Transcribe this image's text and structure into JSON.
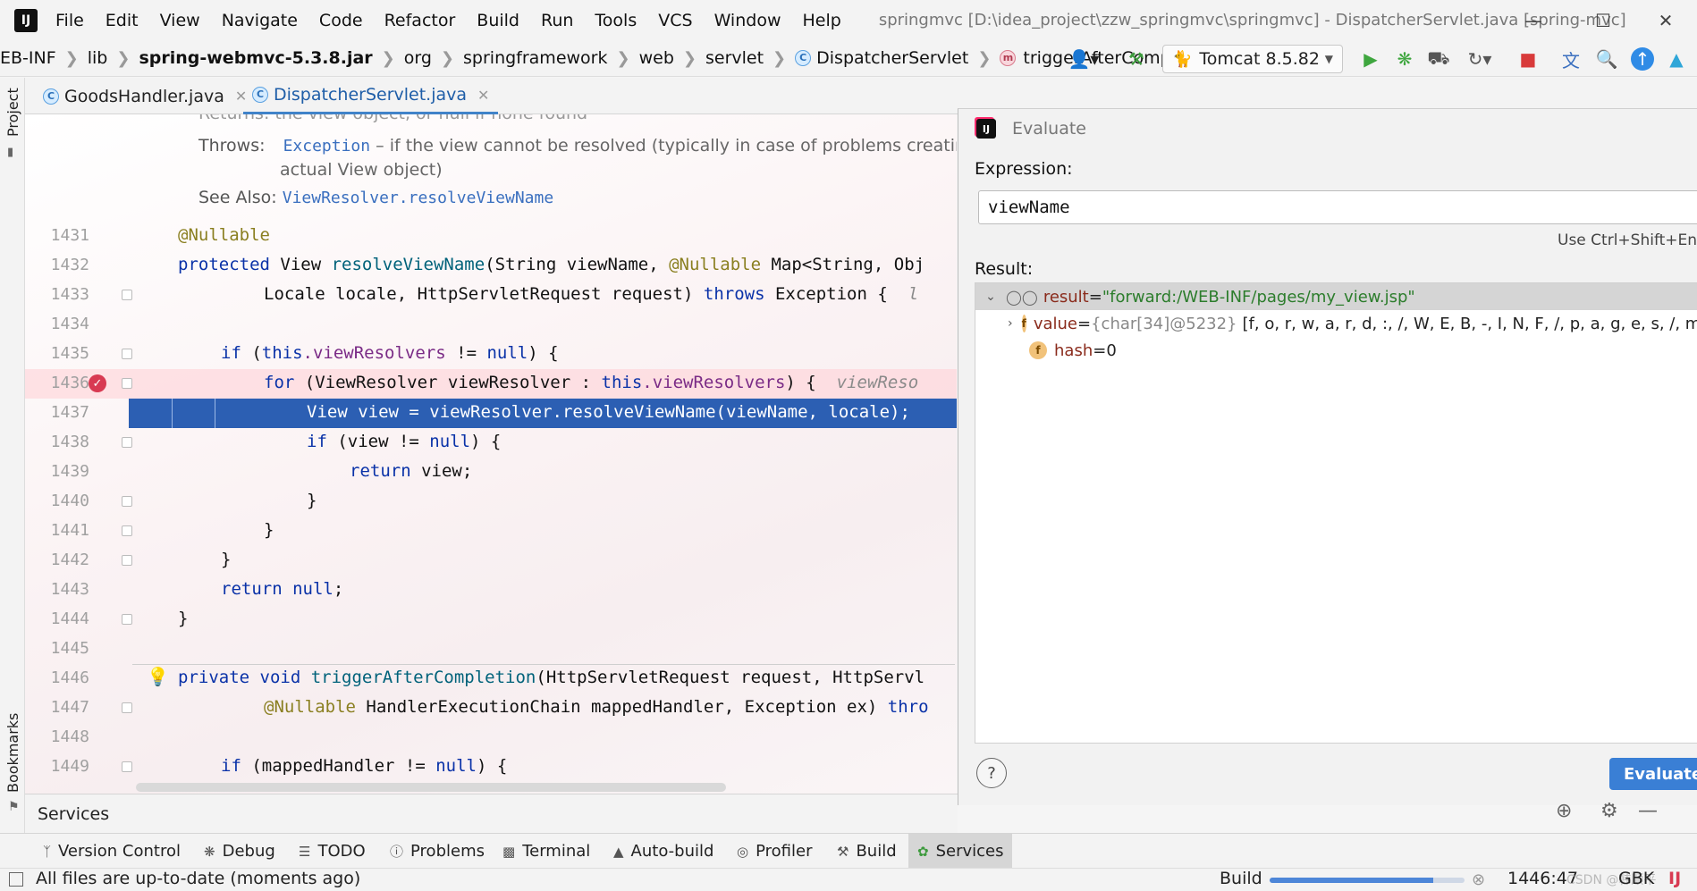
{
  "menubar": {
    "items": [
      "File",
      "Edit",
      "View",
      "Navigate",
      "Code",
      "Refactor",
      "Build",
      "Run",
      "Tools",
      "VCS",
      "Window",
      "Help"
    ],
    "window_title": "springmvc [D:\\idea_project\\zzw_springmvc\\springmvc] - DispatcherServlet.java [spring-mvc]"
  },
  "breadcrumbs": {
    "items": [
      "EB-INF",
      "lib",
      "spring-webmvc-5.3.8.jar",
      "org",
      "springframework",
      "web",
      "servlet",
      "DispatcherServlet",
      "triggerAfterCompletion"
    ]
  },
  "run_config": {
    "label": "Tomcat 8.5.82"
  },
  "left_stripe": {
    "project": "Project",
    "bookmarks": "Bookmarks"
  },
  "editor_tabs": [
    {
      "label": "GoodsHandler.java",
      "active": false
    },
    {
      "label": "DispatcherServlet.java",
      "active": true
    }
  ],
  "doc": {
    "returns_line": "Returns:  the view object, or null if none found",
    "throws_key": "Throws:",
    "throws_link": "Exception",
    "throws_text": " – if the view cannot be resolved (typically in case of problems creating",
    "throws_text2": "actual View object)",
    "see_also_key": "See Also:",
    "see_also_link": "ViewResolver.resolveViewName"
  },
  "code_lines": [
    {
      "n": "1431"
    },
    {
      "n": "1432"
    },
    {
      "n": "1433"
    },
    {
      "n": "1434"
    },
    {
      "n": "1435"
    },
    {
      "n": "1436"
    },
    {
      "n": "1437"
    },
    {
      "n": "1438"
    },
    {
      "n": "1439"
    },
    {
      "n": "1440"
    },
    {
      "n": "1441"
    },
    {
      "n": "1442"
    },
    {
      "n": "1443"
    },
    {
      "n": "1444"
    },
    {
      "n": "1445"
    },
    {
      "n": "1446"
    },
    {
      "n": "1447"
    },
    {
      "n": "1448"
    },
    {
      "n": "1449"
    }
  ],
  "code": {
    "l1431": "@Nullable",
    "l1432_kw": "protected ",
    "l1432_a": "View ",
    "l1432_fn": "resolveViewName",
    "l1432_b": "(String viewName, ",
    "l1432_ann": "@Nullable ",
    "l1432_c": "Map<String, Obj",
    "l1433_a": "Locale locale, HttpServletRequest request) ",
    "l1433_kw": "throws ",
    "l1433_b": "Exception {  ",
    "l1433_hint": "l",
    "l1435_kw": "if ",
    "l1435_a": "(",
    "l1435_this": "this",
    "l1435_fld": ".viewResolvers",
    "l1435_b": " != ",
    "l1435_null": "null",
    "l1435_c": ") {",
    "l1436_kw": "for ",
    "l1436_a": "(ViewResolver viewResolver : ",
    "l1436_this": "this",
    "l1436_fld": ".viewResolvers",
    "l1436_b": ") {  ",
    "l1436_hint": "viewReso",
    "l1437": "View view = viewResolver.resolveViewName(viewName, locale);",
    "l1438_kw": "if ",
    "l1438_a": "(view != ",
    "l1438_null": "null",
    "l1438_b": ") {",
    "l1439_kw": "return ",
    "l1439_a": "view;",
    "l1440": "}",
    "l1441": "}",
    "l1442": "}",
    "l1443_kw": "return ",
    "l1443_null": "null",
    "l1443_a": ";",
    "l1444": "}",
    "l1446_kw": "private void ",
    "l1446_fn": "triggerAfterCompletion",
    "l1446_a": "(HttpServletRequest request, HttpServl",
    "l1447_ann": "@Nullable ",
    "l1447_a": "HandlerExecutionChain mappedHandler, Exception ex) ",
    "l1447_kw": "thro",
    "l1449_kw": "if ",
    "l1449_a": "(mappedHandler != ",
    "l1449_null": "null",
    "l1449_b": ") {"
  },
  "evaluate": {
    "title": "Evaluate",
    "expression_label": "Expression:",
    "expression_value": "viewName",
    "shortcut_hint": "Use Ctrl+Shift+Enter",
    "result_label": "Result:",
    "result_name": "result",
    "result_eq": " = ",
    "result_value": "\"forward:/WEB-INF/pages/my_view.jsp\"",
    "value_name": "value",
    "value_type": "{char[34]@5232}",
    "value_chars": "[f, o, r, w, a, r, d, :, /, W, E, B, -, I, N, F, /, p, a, g, e, s, /, m, y, _",
    "hash_name": "hash",
    "hash_value": "0",
    "evaluate_button": "Evaluate",
    "help_button": "?"
  },
  "services_strip": {
    "label": "Services"
  },
  "tool_windows": [
    {
      "label": "Version Control",
      "icon": "branch-icon"
    },
    {
      "label": "Debug",
      "icon": "bug-icon"
    },
    {
      "label": "TODO",
      "icon": "list-icon"
    },
    {
      "label": "Problems",
      "icon": "problem-icon"
    },
    {
      "label": "Terminal",
      "icon": "terminal-icon"
    },
    {
      "label": "Auto-build",
      "icon": "warning-icon"
    },
    {
      "label": "Profiler",
      "icon": "profiler-icon"
    },
    {
      "label": "Build",
      "icon": "hammer-icon"
    },
    {
      "label": "Services",
      "icon": "services-icon"
    }
  ],
  "statusbar": {
    "message": "All files are up-to-date (moments ago)",
    "build_label": "Build",
    "build_progress": 0.84,
    "cursor_position": "1446:47",
    "encoding": "GBK",
    "watermark": "CSDN @韩顺平"
  },
  "colors": {
    "accent": "#3a7fd5",
    "exec_line": "#2c5fb3",
    "breakpoint": "#d83a52"
  }
}
